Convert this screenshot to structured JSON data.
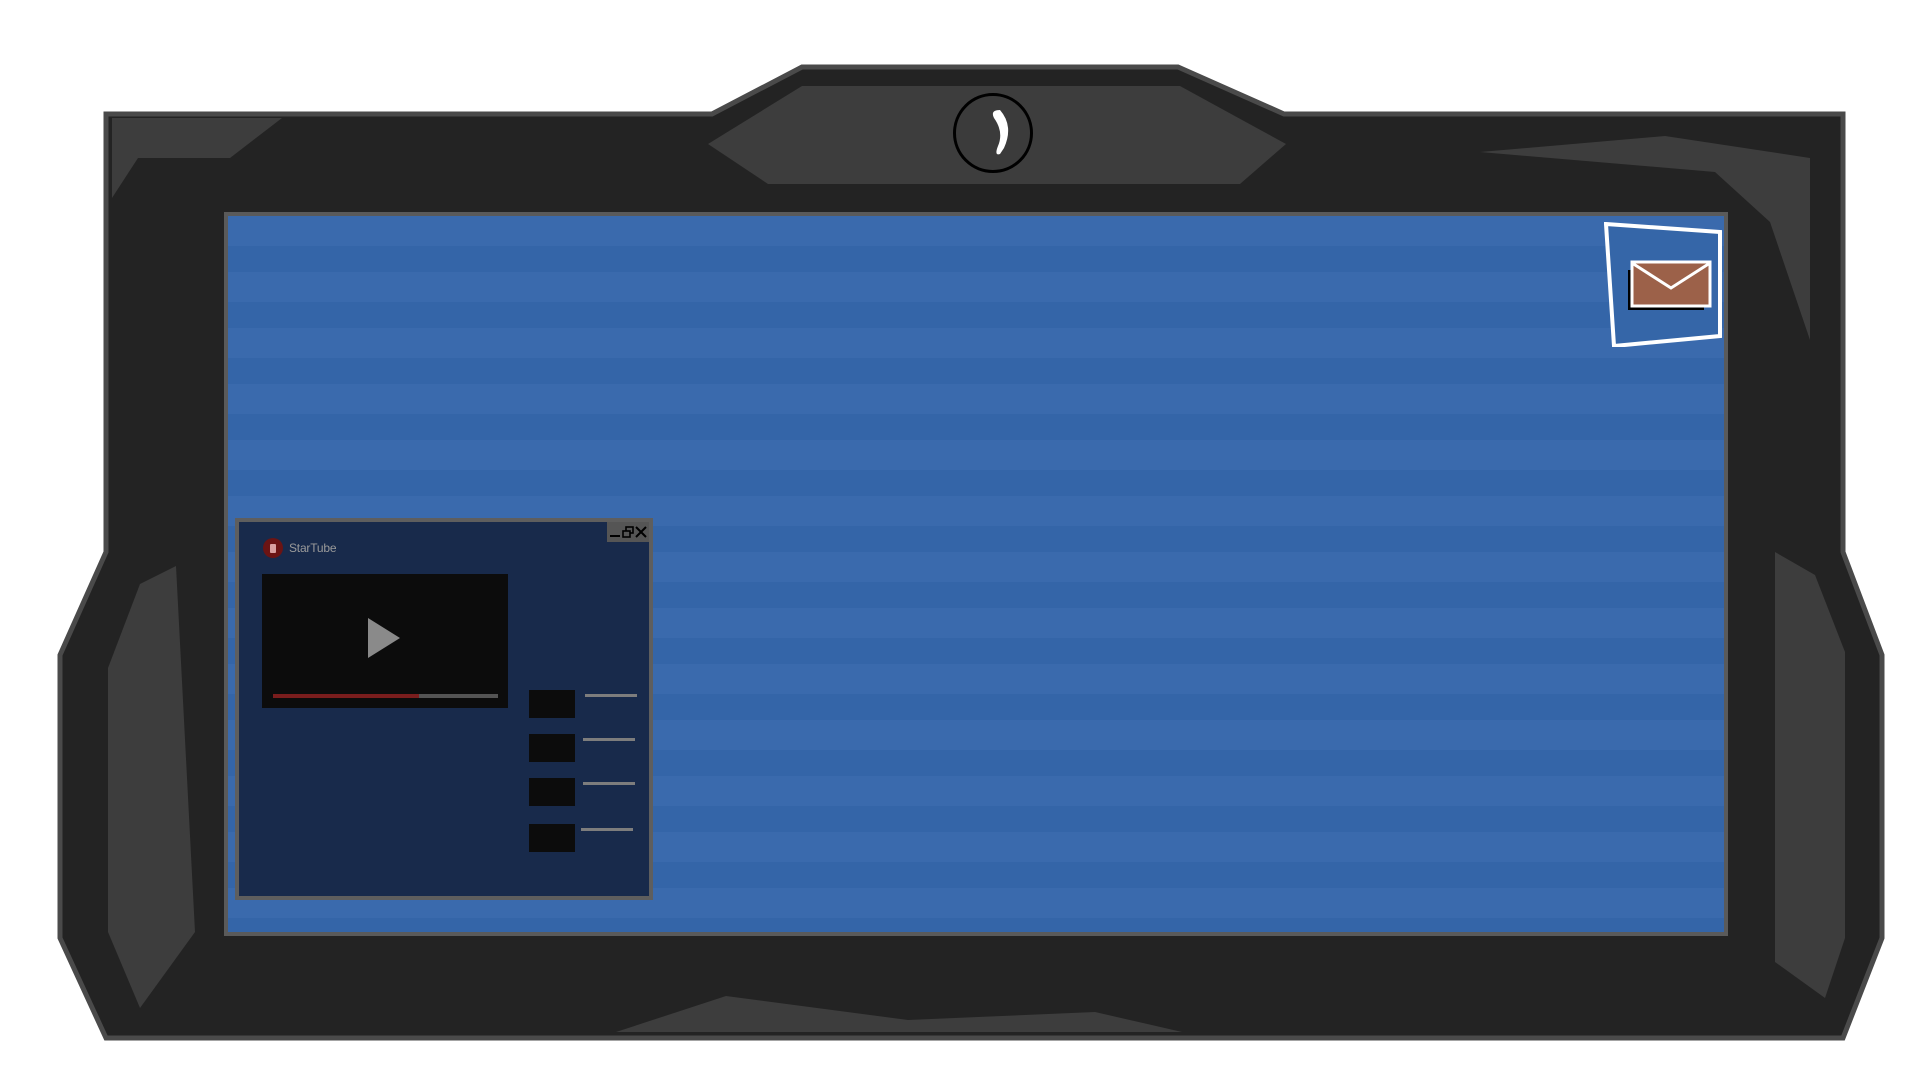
{
  "window": {
    "app_title": "StarTube",
    "logo_icon": "startube-logo-icon",
    "controls": {
      "minimize_icon": "minimize-icon",
      "restore_icon": "restore-icon",
      "close_icon": "close-icon"
    }
  },
  "video": {
    "play_icon": "play-icon",
    "progress": 0.65
  },
  "related_videos": [
    {
      "thumbnail": "video-thumbnail"
    },
    {
      "thumbnail": "video-thumbnail"
    },
    {
      "thumbnail": "video-thumbnail"
    },
    {
      "thumbnail": "video-thumbnail"
    }
  ],
  "device": {
    "power_icon": "power-icon",
    "mail_icon": "envelope-icon"
  },
  "colors": {
    "screen": "#3a6aad",
    "frame": "#232323",
    "frame_accent": "#3d3d3d",
    "window_bg": "#182a4b",
    "envelope": "#9c6149",
    "progress": "#7a1d1d"
  }
}
